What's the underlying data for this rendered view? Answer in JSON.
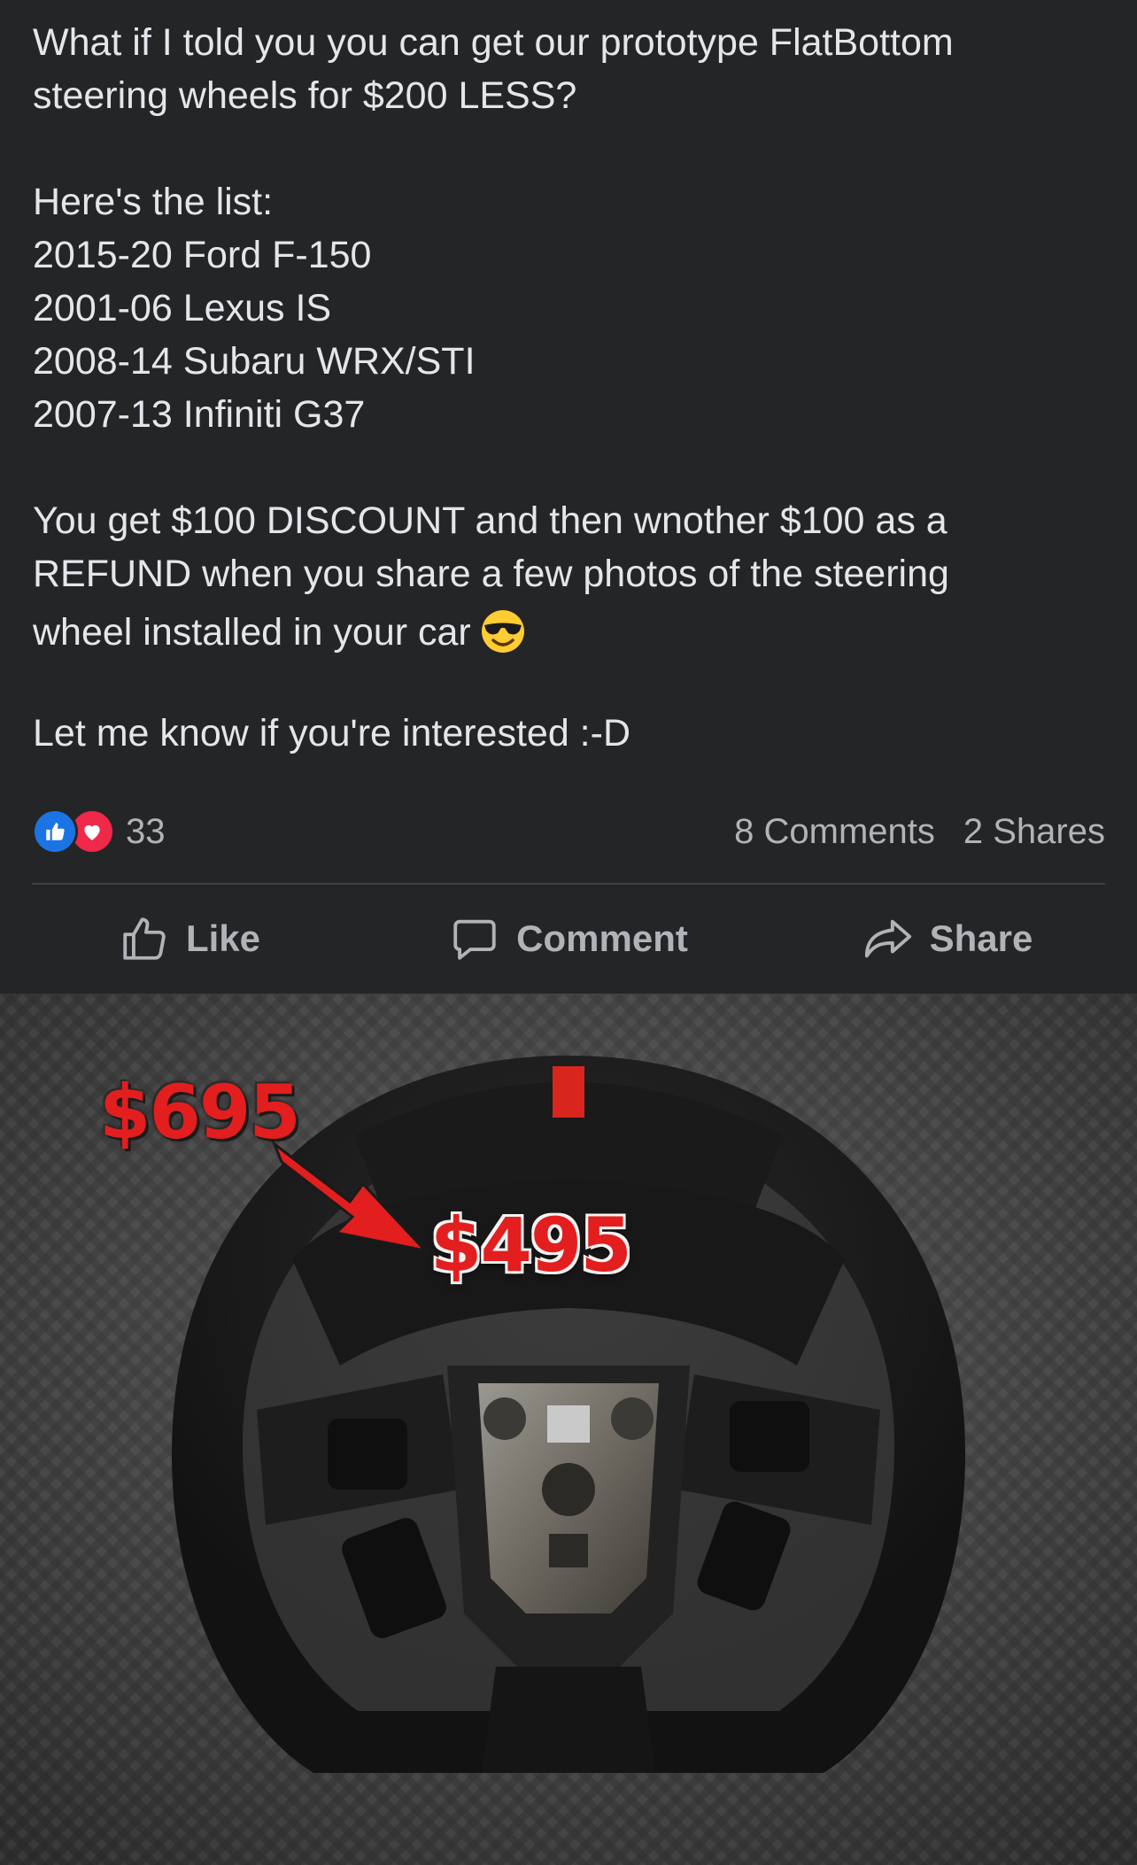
{
  "post": {
    "text": {
      "line1": "What if I told you you can get our prototype FlatBottom",
      "line2": "steering wheels for $200 LESS?",
      "list_header": "Here's the list:",
      "list": [
        "2015-20 Ford F-150",
        "2001-06 Lexus IS",
        "2008-14 Subaru WRX/STI",
        "2007-13 Infiniti G37"
      ],
      "offer_line1": "You get $100 DISCOUNT and then wnother $100 as a",
      "offer_line2": "REFUND when you share a few photos of the steering",
      "offer_line3": "wheel installed in your car",
      "closing": "Let me know if you're interested :-D"
    },
    "emoji_icon": "sunglasses-emoji-icon"
  },
  "stats": {
    "reaction_count": "33",
    "comments": "8 Comments",
    "shares": "2 Shares"
  },
  "actions": {
    "like": "Like",
    "comment": "Comment",
    "share": "Share"
  },
  "photo": {
    "old_price": "$695",
    "new_price": "$495"
  },
  "colors": {
    "background": "#242526",
    "text": "#e4e6eb",
    "muted": "#b0b3b8",
    "like_blue": "#1b74e4",
    "love_red": "#f02849",
    "price_red": "#e31e1e"
  }
}
